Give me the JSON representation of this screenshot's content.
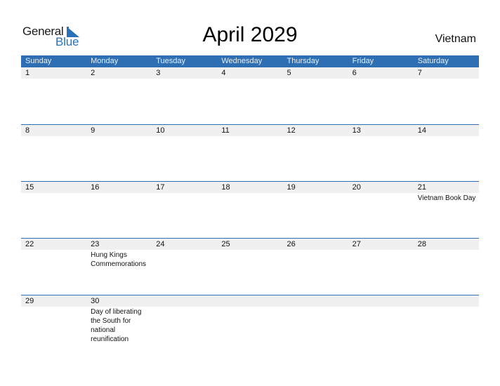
{
  "brand": {
    "word1": "General",
    "word2": "Blue"
  },
  "title": "April 2029",
  "country": "Vietnam",
  "colors": {
    "accent": "#2e6fb3",
    "strip": "#f0f0f0",
    "logo_blue": "#2a72b8"
  },
  "weekdays": [
    "Sunday",
    "Monday",
    "Tuesday",
    "Wednesday",
    "Thursday",
    "Friday",
    "Saturday"
  ],
  "weeks": [
    {
      "days": [
        "1",
        "2",
        "3",
        "4",
        "5",
        "6",
        "7"
      ],
      "events": [
        "",
        "",
        "",
        "",
        "",
        "",
        ""
      ]
    },
    {
      "days": [
        "8",
        "9",
        "10",
        "11",
        "12",
        "13",
        "14"
      ],
      "events": [
        "",
        "",
        "",
        "",
        "",
        "",
        ""
      ]
    },
    {
      "days": [
        "15",
        "16",
        "17",
        "18",
        "19",
        "20",
        "21"
      ],
      "events": [
        "",
        "",
        "",
        "",
        "",
        "",
        "Vietnam Book Day"
      ]
    },
    {
      "days": [
        "22",
        "23",
        "24",
        "25",
        "26",
        "27",
        "28"
      ],
      "events": [
        "",
        "Hung Kings Commemorations",
        "",
        "",
        "",
        "",
        ""
      ]
    },
    {
      "days": [
        "29",
        "30",
        "",
        "",
        "",
        "",
        ""
      ],
      "events": [
        "",
        "Day of liberating the South for national reunification",
        "",
        "",
        "",
        "",
        ""
      ]
    }
  ]
}
